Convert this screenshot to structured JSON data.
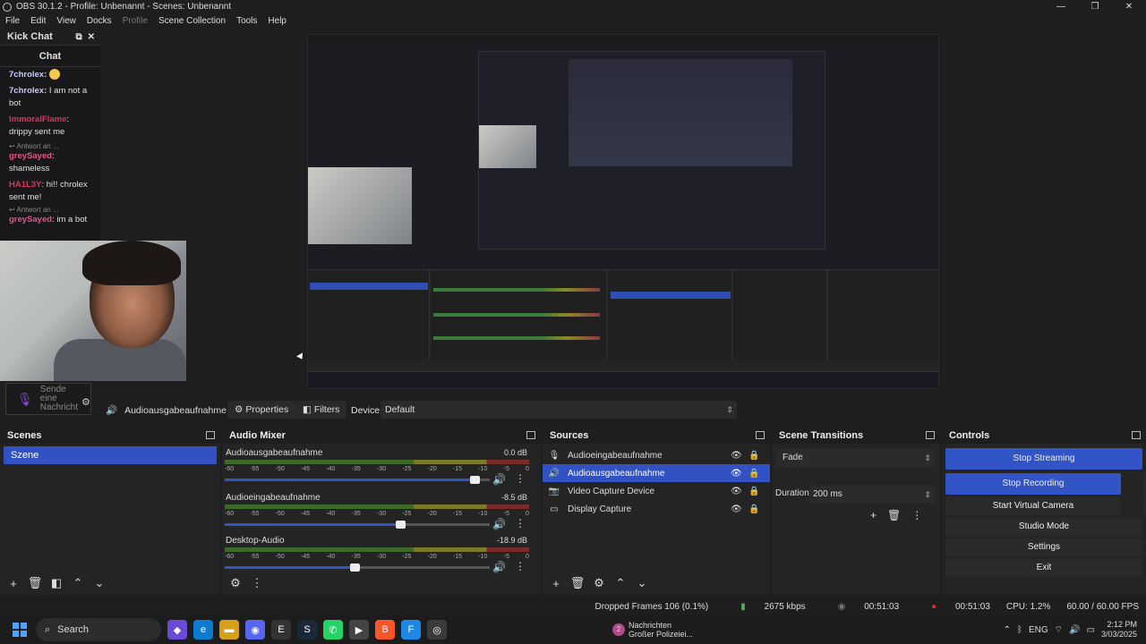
{
  "window": {
    "title": "OBS 30.1.2 - Profile: Unbenannt - Scenes: Unbenannt",
    "controls": [
      "—",
      "❐",
      "✕"
    ]
  },
  "menu": [
    "File",
    "Edit",
    "View",
    "Docks",
    "Profile",
    "Scene Collection",
    "Tools",
    "Help"
  ],
  "kick_chat": {
    "title": "Kick Chat",
    "chat_header": "Chat",
    "messages": [
      {
        "user": "7chrolex",
        "text": ""
      },
      {
        "user": "7chrolex",
        "text": "I am not a bot"
      },
      {
        "user": "ImmoralFlame",
        "text": "drippy sent me"
      },
      {
        "reply": "Antwort an ...",
        "user": "greySayed",
        "text": "shameless"
      },
      {
        "user": "HA1L3Y",
        "text": "hi!! chrolex sent me!"
      },
      {
        "reply": "Antwort an ...",
        "user": "greySayed",
        "text": "im a bot"
      }
    ],
    "input_placeholder": "Sende eine Nachricht"
  },
  "context_bar": {
    "source": "Audioausgabeaufnahme",
    "properties": "Properties",
    "filters": "Filters",
    "device_label": "Device",
    "device_value": "Default"
  },
  "scenes": {
    "title": "Scenes",
    "items": [
      "Szene"
    ]
  },
  "audio_mixer": {
    "title": "Audio Mixer",
    "ticks": [
      "-60",
      "-55",
      "-50",
      "-45",
      "-40",
      "-35",
      "-30",
      "-25",
      "-20",
      "-15",
      "-10",
      "-5",
      "0"
    ],
    "channels": [
      {
        "name": "Audioausgabeaufnahme",
        "db": "0.0 dB",
        "volume": 0.96
      },
      {
        "name": "Audioeingabeaufnahme",
        "db": "-8.5 dB",
        "volume": 0.67
      },
      {
        "name": "Desktop-Audio",
        "db": "-18.9 dB",
        "volume": 0.49
      }
    ]
  },
  "sources": {
    "title": "Sources",
    "items": [
      {
        "name": "Audioeingabeaufnahme",
        "icon": "mic-icon",
        "selected": false
      },
      {
        "name": "Audioausgabeaufnahme",
        "icon": "speaker-icon",
        "selected": true
      },
      {
        "name": "Video Capture Device",
        "icon": "camera-icon",
        "selected": false
      },
      {
        "name": "Display Capture",
        "icon": "monitor-icon",
        "selected": false
      }
    ]
  },
  "scene_transitions": {
    "title": "Scene Transitions",
    "transition": "Fade",
    "duration_label": "Duration",
    "duration_value": "200 ms"
  },
  "controls": {
    "title": "Controls",
    "stop_streaming": "Stop Streaming",
    "stop_recording": "Stop Recording",
    "start_virtual_camera": "Start Virtual Camera",
    "studio_mode": "Studio Mode",
    "settings": "Settings",
    "exit": "Exit"
  },
  "status": {
    "dropped_frames": "Dropped Frames 106 (0.1%)",
    "bitrate": "2675 kbps",
    "stream_time": "00:51:03",
    "rec_time": "00:51:03",
    "cpu": "CPU: 1.2%",
    "fps": "60.00 / 60.00 FPS"
  },
  "taskbar": {
    "search": "Search",
    "notification_title": "Nachrichten",
    "notification_sub": "Großer Polizeiei...",
    "notification_count": "2",
    "language": "ENG",
    "time": "2:12 PM",
    "date": "3/03/2025"
  },
  "colors": {
    "accent": "#3252c4",
    "background": "#1f1e1f",
    "panel": "#242424"
  }
}
